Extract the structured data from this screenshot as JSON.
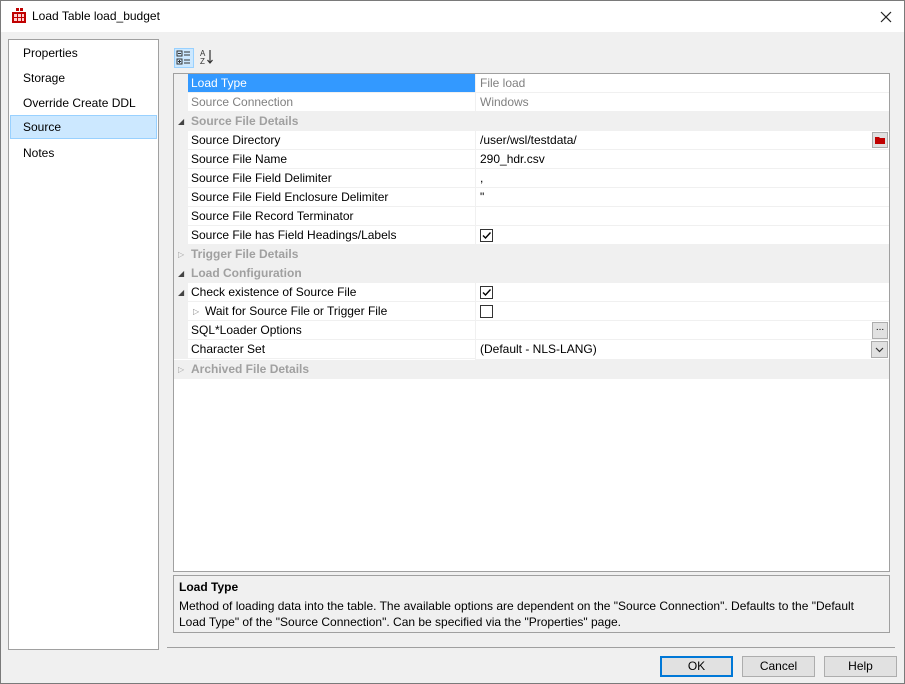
{
  "window": {
    "title": "Load Table load_budget"
  },
  "nav": {
    "items": [
      {
        "label": "Properties",
        "selected": false
      },
      {
        "label": "Storage",
        "selected": false
      },
      {
        "label": "Override Create DDL",
        "selected": false
      },
      {
        "label": "Source",
        "selected": true
      },
      {
        "label": "Notes",
        "selected": false
      }
    ]
  },
  "grid": {
    "load_type": {
      "name": "Load Type",
      "value": "File load"
    },
    "source_connection": {
      "name": "Source Connection",
      "value": "Windows"
    },
    "cat_source_file_details": "Source File Details",
    "source_directory": {
      "name": "Source Directory",
      "value": "/user/wsl/testdata/"
    },
    "source_file_name": {
      "name": "Source File Name",
      "value": "290_hdr.csv"
    },
    "field_delimiter": {
      "name": "Source File Field Delimiter",
      "value": ","
    },
    "enclosure_delimiter": {
      "name": "Source File Field Enclosure Delimiter",
      "value": "\""
    },
    "record_terminator": {
      "name": "Source File Record Terminator",
      "value": ""
    },
    "has_headings": {
      "name": "Source File has Field Headings/Labels",
      "checked": true
    },
    "cat_trigger_file_details": "Trigger File Details",
    "cat_load_configuration": "Load Configuration",
    "check_existence": {
      "name": "Check existence of Source File",
      "checked": true
    },
    "wait_for_file": {
      "name": "Wait for Source File or Trigger File",
      "checked": false
    },
    "sqlloader_options": {
      "name": "SQL*Loader Options",
      "value": "",
      "button": "..."
    },
    "character_set": {
      "name": "Character Set",
      "value": "(Default - NLS-LANG)"
    },
    "cat_archived_file_details": "Archived File Details"
  },
  "description": {
    "title": "Load Type",
    "text": "Method of loading data into the table. The available options are dependent on the \"Source Connection\". Defaults to the \"Default Load Type\" of the \"Source Connection\". Can be specified via the \"Properties\" page."
  },
  "buttons": {
    "ok": "OK",
    "cancel": "Cancel",
    "help": "Help"
  },
  "colors": {
    "selection": "#3399ff",
    "nav_selection": "#cce8ff",
    "category_text": "#a0a0a0"
  }
}
